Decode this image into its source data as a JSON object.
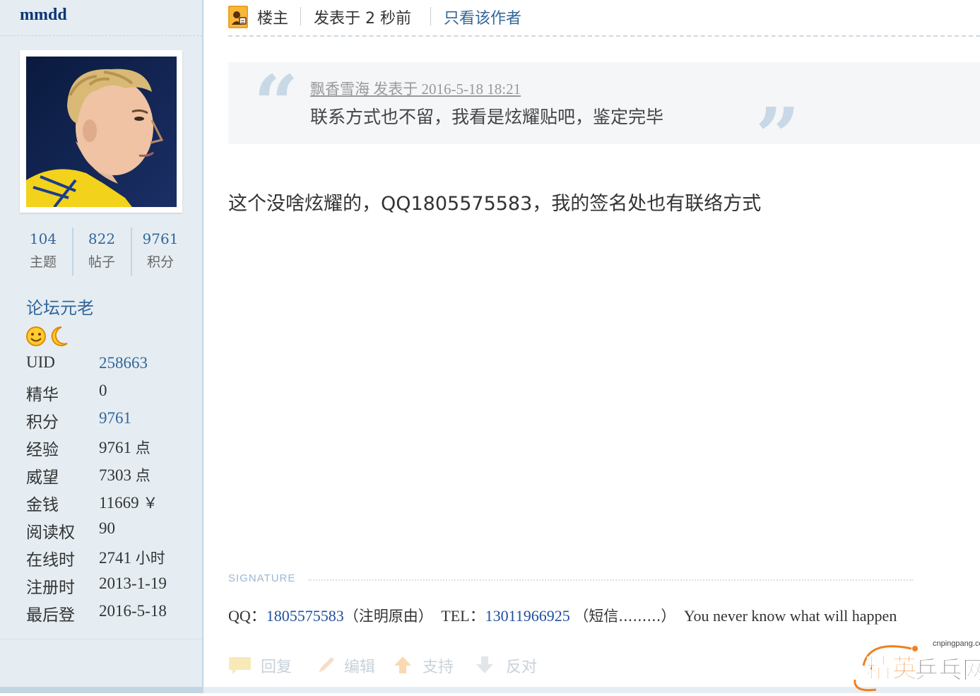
{
  "sidebar": {
    "username": "mmdd",
    "stats": [
      {
        "value": "104",
        "label": "主题"
      },
      {
        "value": "822",
        "label": "帖子"
      },
      {
        "value": "9761",
        "label": "积分"
      }
    ],
    "group": "论坛元老",
    "medal_icons": [
      "smiley-face-icon",
      "crescent-moon-icon"
    ],
    "info": {
      "uid": {
        "k": "UID",
        "v": "258663"
      },
      "digest": {
        "k": "精华",
        "v": "0"
      },
      "credits": {
        "k": "积分",
        "v": "9761"
      },
      "exp": {
        "k": "经验",
        "v": "9761",
        "unit": "点"
      },
      "prestige": {
        "k": "威望",
        "v": "7303",
        "unit": "点"
      },
      "money": {
        "k": "金钱",
        "v": "11669",
        "unit": "￥"
      },
      "read_perm": {
        "k": "阅读权",
        "v": "90"
      },
      "online": {
        "k": "在线时",
        "v": "2741",
        "unit": "小时"
      },
      "reg": {
        "k": "注册时",
        "v": "2013-1-19"
      },
      "last_login": {
        "k": "最后登",
        "v": "2016-5-18"
      }
    }
  },
  "post": {
    "owner_label": "楼主",
    "posted_time": "发表于 2 秒前",
    "only_author": "只看该作者",
    "quote": {
      "meta": "飘香雪海 发表于 2016-5-18 18:21",
      "text": "联系方式也不留，我看是炫耀贴吧，鉴定完毕"
    },
    "body": "这个没啥炫耀的，QQ1805575583，我的签名处也有联络方式",
    "signature_label": "SIGNATURE",
    "signature": {
      "qq_label": "QQ：",
      "qq": "1805575583",
      "qq_note": "（注明原由）",
      "tel_label": "TEL：",
      "tel": "13011966925",
      "tel_note": "（短信.........）",
      "tagline": "You never know what will happen"
    },
    "actions": {
      "reply": "回复",
      "edit": "编辑",
      "support": "支持",
      "oppose": "反对"
    }
  },
  "watermark": {
    "site": "cnpingpang.com",
    "brand_a": "精英",
    "brand_b": "乒乓网"
  }
}
